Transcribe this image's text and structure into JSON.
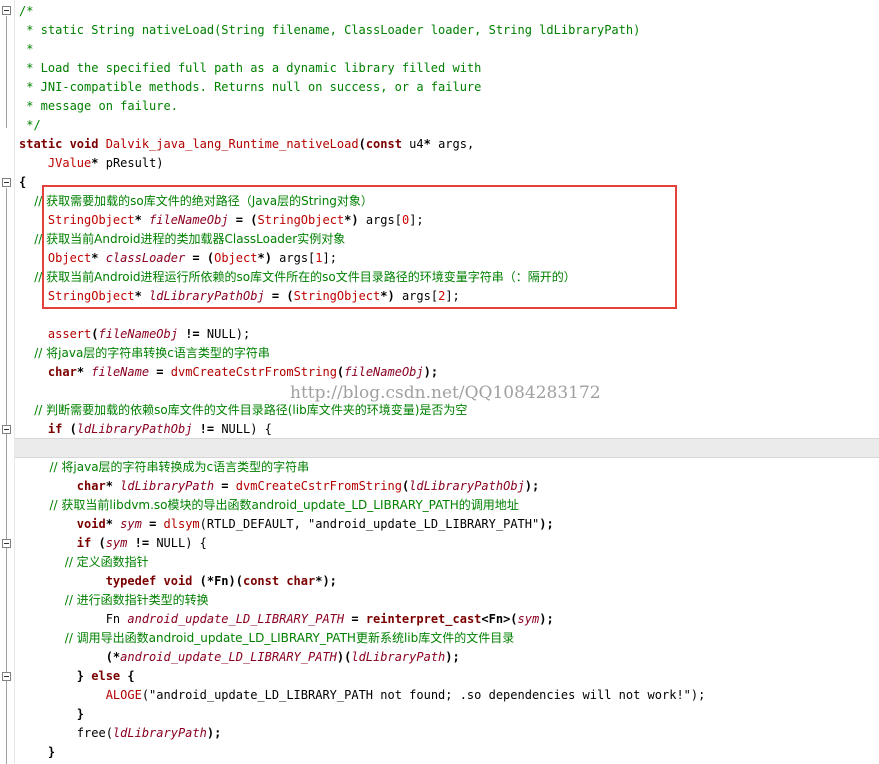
{
  "editor": {
    "lines": [
      [
        {
          "t": "/*",
          "c": "cm"
        }
      ],
      [
        {
          "t": " * static String nativeLoad(String filename, ClassLoader loader, String ldLibraryPath)",
          "c": "cm"
        }
      ],
      [
        {
          "t": " *",
          "c": "cm"
        }
      ],
      [
        {
          "t": " * Load the specified full path as a dynamic library filled with",
          "c": "cm"
        }
      ],
      [
        {
          "t": " * JNI-compatible methods. Returns null on success, or a failure",
          "c": "cm"
        }
      ],
      [
        {
          "t": " * message on failure.",
          "c": "cm"
        }
      ],
      [
        {
          "t": " */",
          "c": "cm"
        }
      ],
      [
        {
          "t": "static void ",
          "c": "kw"
        },
        {
          "t": "Dalvik_java_lang_Runtime_nativeLoad",
          "c": "fn"
        },
        {
          "t": "(",
          "c": "op"
        },
        {
          "t": "const ",
          "c": "kw"
        },
        {
          "t": "u4",
          "c": "pl"
        },
        {
          "t": "* ",
          "c": "op"
        },
        {
          "t": "args,",
          "c": "pl"
        }
      ],
      [
        {
          "t": "    ",
          "c": "pl"
        },
        {
          "t": "JValue",
          "c": "ty"
        },
        {
          "t": "* ",
          "c": "op"
        },
        {
          "t": "pResult)",
          "c": "pl"
        }
      ],
      [
        {
          "t": "{",
          "c": "op"
        }
      ],
      [
        {
          "t": "    // 获取需要加载的so库文件的绝对路径（Java层的String对象）",
          "c": "cm cjk"
        }
      ],
      [
        {
          "t": "    ",
          "c": "pl"
        },
        {
          "t": "StringObject",
          "c": "ty"
        },
        {
          "t": "* ",
          "c": "op"
        },
        {
          "t": "fileNameObj",
          "c": "vr"
        },
        {
          "t": " = (",
          "c": "op"
        },
        {
          "t": "StringObject",
          "c": "ty"
        },
        {
          "t": "*) ",
          "c": "op"
        },
        {
          "t": "args[",
          "c": "pl"
        },
        {
          "t": "0",
          "c": "nm"
        },
        {
          "t": "];",
          "c": "pl"
        }
      ],
      [
        {
          "t": "    // 获取当前Android进程的类加载器ClassLoader实例对象",
          "c": "cm cjk"
        }
      ],
      [
        {
          "t": "    ",
          "c": "pl"
        },
        {
          "t": "Object",
          "c": "ty"
        },
        {
          "t": "* ",
          "c": "op"
        },
        {
          "t": "classLoader",
          "c": "vr"
        },
        {
          "t": " = (",
          "c": "op"
        },
        {
          "t": "Object",
          "c": "ty"
        },
        {
          "t": "*) ",
          "c": "op"
        },
        {
          "t": "args[",
          "c": "pl"
        },
        {
          "t": "1",
          "c": "nm"
        },
        {
          "t": "];",
          "c": "pl"
        }
      ],
      [
        {
          "t": "    // 获取当前Android进程运行所依赖的so库文件所在的so文件目录路径的环境变量字符串（：隔开的）",
          "c": "cm cjk"
        }
      ],
      [
        {
          "t": "    ",
          "c": "pl"
        },
        {
          "t": "StringObject",
          "c": "ty"
        },
        {
          "t": "* ",
          "c": "op"
        },
        {
          "t": "ldLibraryPathObj",
          "c": "vr"
        },
        {
          "t": " = (",
          "c": "op"
        },
        {
          "t": "StringObject",
          "c": "ty"
        },
        {
          "t": "*) ",
          "c": "op"
        },
        {
          "t": "args[",
          "c": "pl"
        },
        {
          "t": "2",
          "c": "nm"
        },
        {
          "t": "];",
          "c": "pl"
        }
      ],
      [
        {
          "t": "",
          "c": "pl"
        }
      ],
      [
        {
          "t": "    ",
          "c": "pl"
        },
        {
          "t": "assert",
          "c": "fn"
        },
        {
          "t": "(",
          "c": "op"
        },
        {
          "t": "fileNameObj",
          "c": "vr"
        },
        {
          "t": " != ",
          "c": "op"
        },
        {
          "t": "NULL);",
          "c": "pl"
        }
      ],
      [
        {
          "t": "    // 将java层的字符串转换c语言类型的字符串",
          "c": "cm cjk"
        }
      ],
      [
        {
          "t": "    ",
          "c": "pl"
        },
        {
          "t": "char",
          "c": "kw"
        },
        {
          "t": "* ",
          "c": "op"
        },
        {
          "t": "fileName",
          "c": "vr"
        },
        {
          "t": " = ",
          "c": "op"
        },
        {
          "t": "dvmCreateCstrFromString",
          "c": "fn"
        },
        {
          "t": "(",
          "c": "op"
        },
        {
          "t": "fileNameObj",
          "c": "vr"
        },
        {
          "t": ");",
          "c": "op"
        }
      ],
      [
        {
          "t": "",
          "c": "pl"
        }
      ],
      [
        {
          "t": "    // 判断需要加载的依赖so库文件的文件目录路径(lib库文件夹的环境变量)是否为空",
          "c": "cm cjk"
        }
      ],
      [
        {
          "t": "    ",
          "c": "pl"
        },
        {
          "t": "if ",
          "c": "kw"
        },
        {
          "t": "(",
          "c": "op"
        },
        {
          "t": "ldLibraryPathObj",
          "c": "vr"
        },
        {
          "t": " != ",
          "c": "op"
        },
        {
          "t": "NULL) {",
          "c": "pl"
        }
      ],
      [
        {
          "t": "",
          "c": "pl"
        }
      ],
      [
        {
          "t": "        // 将java层的字符串转换成为c语言类型的字符串",
          "c": "cm cjk"
        }
      ],
      [
        {
          "t": "        ",
          "c": "pl"
        },
        {
          "t": "char",
          "c": "kw"
        },
        {
          "t": "* ",
          "c": "op"
        },
        {
          "t": "ldLibraryPath",
          "c": "vr"
        },
        {
          "t": " = ",
          "c": "op"
        },
        {
          "t": "dvmCreateCstrFromString",
          "c": "fn"
        },
        {
          "t": "(",
          "c": "op"
        },
        {
          "t": "ldLibraryPathObj",
          "c": "vr"
        },
        {
          "t": ");",
          "c": "op"
        }
      ],
      [
        {
          "t": "        // 获取当前libdvm.so模块的导出函数android_update_LD_LIBRARY_PATH的调用地址",
          "c": "cm cjk"
        }
      ],
      [
        {
          "t": "        ",
          "c": "pl"
        },
        {
          "t": "void",
          "c": "kw"
        },
        {
          "t": "* ",
          "c": "op"
        },
        {
          "t": "sym",
          "c": "vr"
        },
        {
          "t": " = ",
          "c": "op"
        },
        {
          "t": "dlsym",
          "c": "fn"
        },
        {
          "t": "(RTLD_DEFAULT, ",
          "c": "pl"
        },
        {
          "t": "\"android_update_LD_LIBRARY_PATH\"",
          "c": "pl"
        },
        {
          "t": ");",
          "c": "op"
        }
      ],
      [
        {
          "t": "        ",
          "c": "pl"
        },
        {
          "t": "if ",
          "c": "kw"
        },
        {
          "t": "(",
          "c": "op"
        },
        {
          "t": "sym",
          "c": "vr"
        },
        {
          "t": " != ",
          "c": "op"
        },
        {
          "t": "NULL) {",
          "c": "pl"
        }
      ],
      [
        {
          "t": "            // 定义函数指针",
          "c": "cm cjk"
        }
      ],
      [
        {
          "t": "            ",
          "c": "pl"
        },
        {
          "t": "typedef void ",
          "c": "kw"
        },
        {
          "t": "(*Fn)(",
          "c": "op"
        },
        {
          "t": "const char",
          "c": "kw"
        },
        {
          "t": "*);",
          "c": "op"
        }
      ],
      [
        {
          "t": "            // 进行函数指针类型的转换",
          "c": "cm cjk"
        }
      ],
      [
        {
          "t": "            Fn ",
          "c": "pl"
        },
        {
          "t": "android_update_LD_LIBRARY_PATH",
          "c": "vr"
        },
        {
          "t": " = ",
          "c": "op"
        },
        {
          "t": "reinterpret_cast",
          "c": "kw"
        },
        {
          "t": "<Fn>(",
          "c": "op"
        },
        {
          "t": "sym",
          "c": "vr"
        },
        {
          "t": ");",
          "c": "op"
        }
      ],
      [
        {
          "t": "            // 调用导出函数android_update_LD_LIBRARY_PATH更新系统lib库文件的文件目录",
          "c": "cm cjk"
        }
      ],
      [
        {
          "t": "            (*",
          "c": "op"
        },
        {
          "t": "android_update_LD_LIBRARY_PATH",
          "c": "vr"
        },
        {
          "t": ")(",
          "c": "op"
        },
        {
          "t": "ldLibraryPath",
          "c": "vr"
        },
        {
          "t": ");",
          "c": "op"
        }
      ],
      [
        {
          "t": "        } ",
          "c": "op"
        },
        {
          "t": "else ",
          "c": "kw"
        },
        {
          "t": "{",
          "c": "op"
        }
      ],
      [
        {
          "t": "            ",
          "c": "pl"
        },
        {
          "t": "ALOGE",
          "c": "fn"
        },
        {
          "t": "(\"android_update_LD_LIBRARY_PATH not found; .so dependencies will not work!\");",
          "c": "pl"
        }
      ],
      [
        {
          "t": "        }",
          "c": "op"
        }
      ],
      [
        {
          "t": "        free(",
          "c": "pl"
        },
        {
          "t": "ldLibraryPath",
          "c": "vr"
        },
        {
          "t": ");",
          "c": "op"
        }
      ],
      [
        {
          "t": "    }",
          "c": "op"
        }
      ]
    ]
  },
  "watermark": "http://blog.csdn.net/QQ1084283172"
}
